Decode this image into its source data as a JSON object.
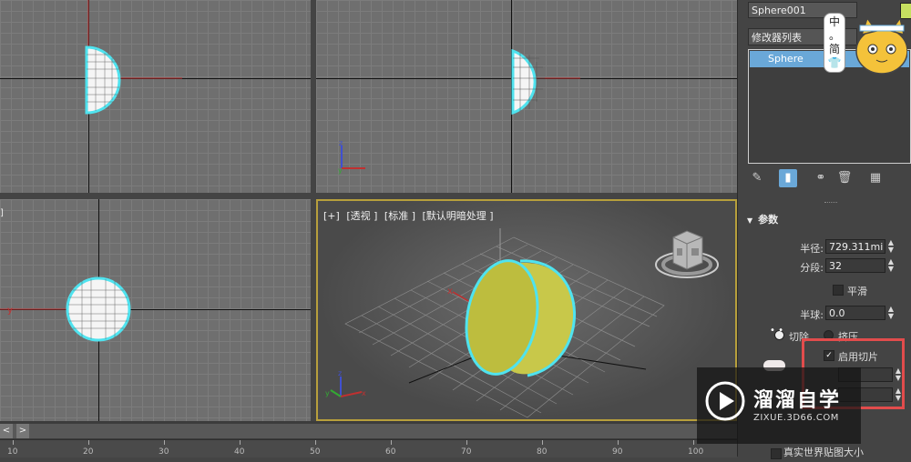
{
  "viewports": {
    "perspective_label": [
      "[+]",
      "[透视 ]",
      "[标准 ]",
      "[默认明暗处理 ]"
    ],
    "left_corner_mark": "]"
  },
  "timeline": {
    "prev_label": "<",
    "next_label": ">",
    "ticks": [
      "10",
      "20",
      "30",
      "40",
      "50",
      "60",
      "70",
      "80",
      "90",
      "100"
    ]
  },
  "panel": {
    "object_name": "Sphere001",
    "object_color": "#c6e060",
    "modifier_list": "修改器列表",
    "stack_item": "Sphere",
    "rollout_title": "参数",
    "params": {
      "radius_label": "半径:",
      "radius_value": "729.311mi",
      "segments_label": "分段:",
      "segments_value": "32",
      "smooth_label": "平滑",
      "hemisphere_label": "半球:",
      "hemisphere_value": "0.0",
      "chop_label": "切除",
      "squash_label": "挤压",
      "slice_label": "启用切片",
      "slice_from_value": "",
      "slice_to_value": "",
      "bottom_label": "真实世界贴图大小"
    }
  },
  "watermark": {
    "title": "溜溜自学",
    "url": "ZIXUE.3D66.COM"
  },
  "mascot": {
    "speech": "中\n。\n简\n👕"
  },
  "colors": {
    "accent_highlight": "#e24c4c",
    "selection_blue": "#6aa8d8",
    "object_cyan": "#4fe3ef",
    "object_yellow": "#c8c84a"
  }
}
